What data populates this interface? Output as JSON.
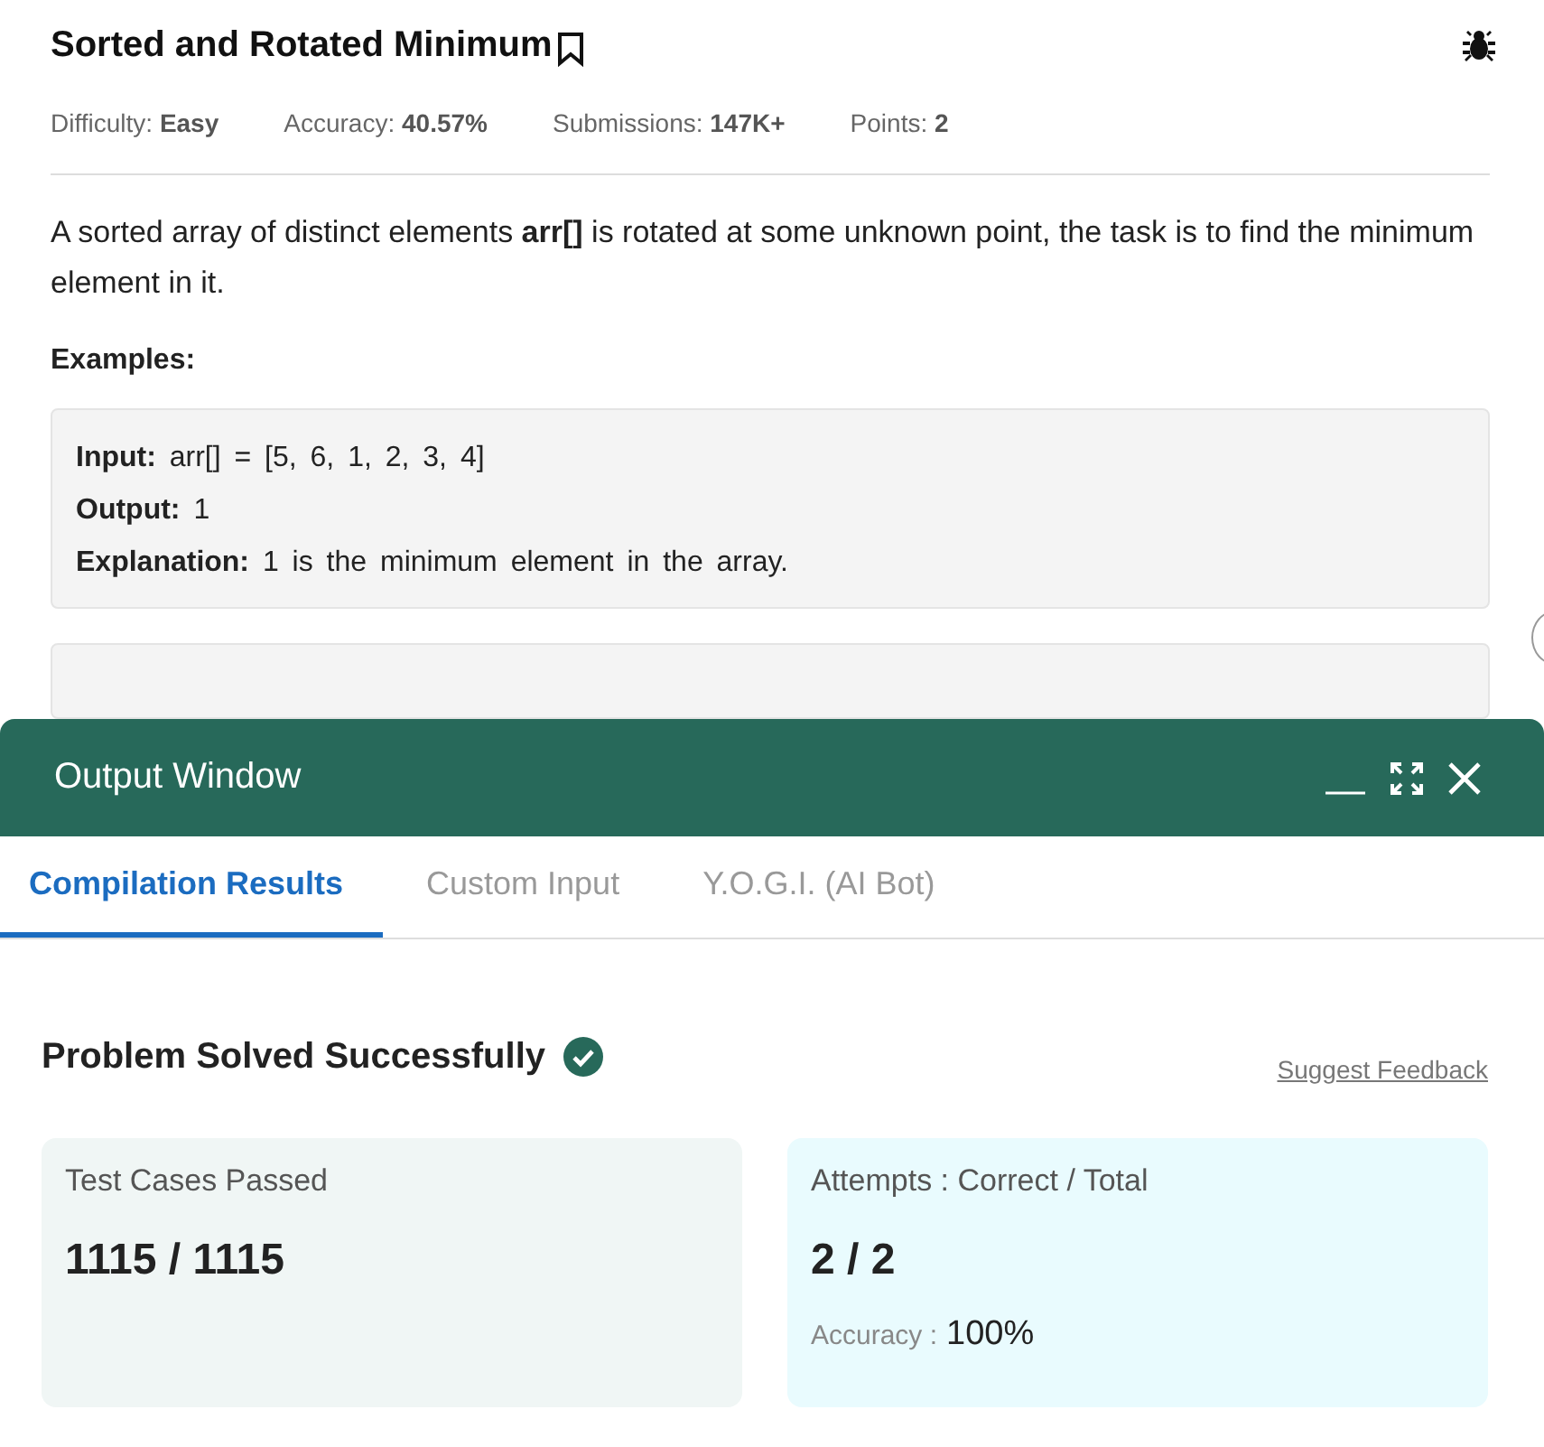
{
  "problem": {
    "title": "Sorted and Rotated Minimum",
    "meta": [
      {
        "label": "Difficulty:",
        "value": "Easy"
      },
      {
        "label": "Accuracy:",
        "value": "40.57%"
      },
      {
        "label": "Submissions:",
        "value": "147K+"
      },
      {
        "label": "Points:",
        "value": "2"
      }
    ],
    "description": "A sorted array of distinct elements **arr[]** is rotated at some unknown point, the task is to find the minimum element in it.",
    "examples_heading": "Examples:",
    "examples": [
      {
        "lines": [
          {
            "label": "Input:",
            "text": "arr[] = [5, 6, 1, 2, 3, 4]"
          },
          {
            "label": "Output:",
            "text": "1"
          },
          {
            "label": "Explanation:",
            "text": "1 is the minimum element in the array."
          }
        ]
      }
    ]
  },
  "output_window": {
    "title": "Output Window",
    "tabs": [
      {
        "label": "Compilation Results",
        "selected": true
      },
      {
        "label": "Custom Input",
        "selected": false
      },
      {
        "label": "Y.O.G.I. (AI Bot)",
        "selected": false
      }
    ],
    "result": {
      "heading": "Problem Solved Successfully",
      "feedback_link": "Suggest Feedback"
    },
    "cards": [
      {
        "label": "Test Cases Passed",
        "value": "1115 / 1115"
      },
      {
        "label": "Attempts : Correct / Total",
        "value": "2 / 2",
        "accuracy_label": "Accuracy :",
        "accuracy_value": "100%"
      }
    ]
  }
}
